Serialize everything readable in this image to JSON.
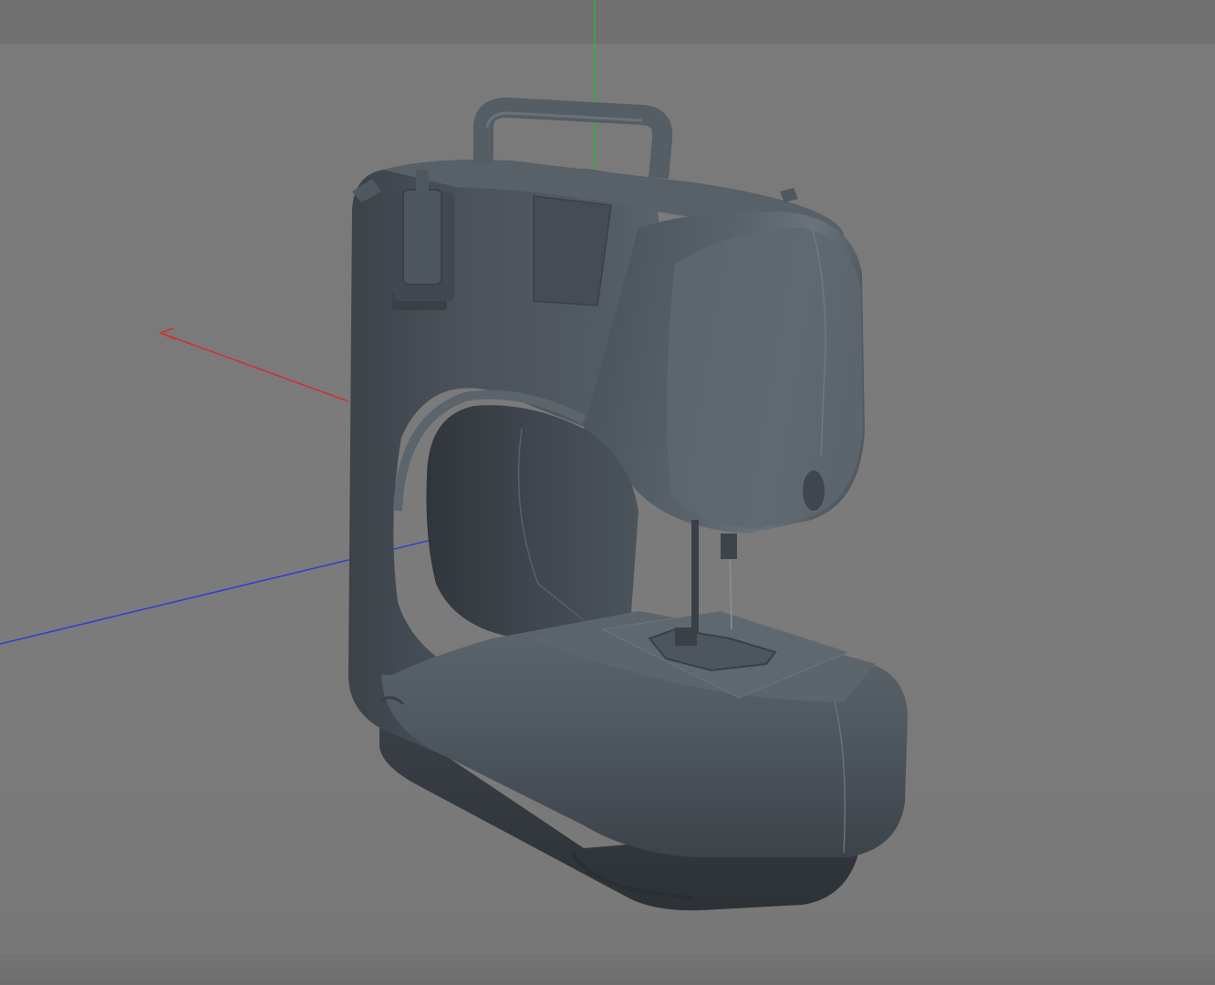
{
  "viewport": {
    "name": "3D viewport",
    "background_color": "#7a7a7a",
    "model": "sewing-machine",
    "model_color": "#4a5158"
  },
  "axes": {
    "x_color": "#d03030",
    "y_color": "#30b040",
    "z_color": "#2f3fd0"
  }
}
